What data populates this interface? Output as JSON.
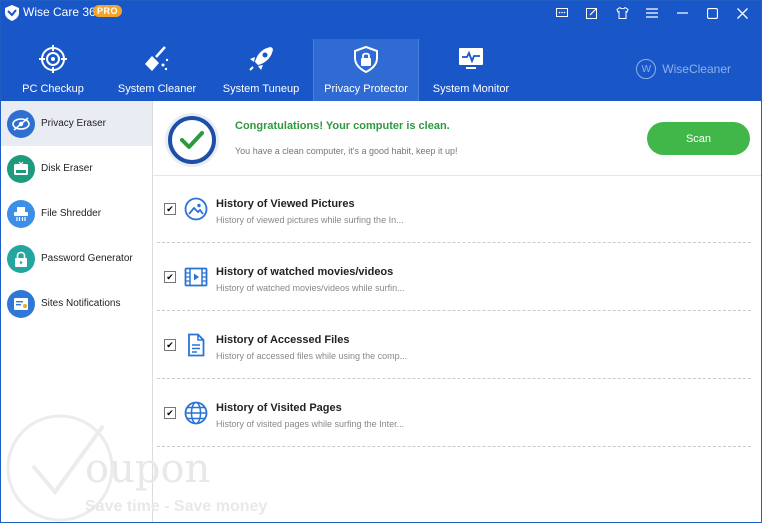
{
  "app": {
    "title": "Wise Care 365",
    "badge": "PRO",
    "brand": "WiseCleaner",
    "brand_initial": "W"
  },
  "window_controls": [
    "chat-icon",
    "edit-icon",
    "shirt-icon",
    "menu-icon",
    "minimize-icon",
    "maximize-icon",
    "close-icon"
  ],
  "nav": {
    "tabs": [
      {
        "label": "PC Checkup",
        "icon": "target-icon"
      },
      {
        "label": "System Cleaner",
        "icon": "broom-icon"
      },
      {
        "label": "System Tuneup",
        "icon": "rocket-icon"
      },
      {
        "label": "Privacy Protector",
        "icon": "lock-shield-icon",
        "active": true
      },
      {
        "label": "System Monitor",
        "icon": "monitor-icon"
      }
    ]
  },
  "sidebar": {
    "items": [
      {
        "label": "Privacy Eraser",
        "icon": "eye-slash-icon",
        "color": "#2f6fd2",
        "active": true
      },
      {
        "label": "Disk Eraser",
        "icon": "disk-icon",
        "color": "#1e9a7d"
      },
      {
        "label": "File Shredder",
        "icon": "shredder-icon",
        "color": "#3d8ee6"
      },
      {
        "label": "Password Generator",
        "icon": "padlock-icon",
        "color": "#23a6a0"
      },
      {
        "label": "Sites Notifications",
        "icon": "notification-icon",
        "color": "#2f78d6"
      }
    ]
  },
  "status": {
    "title": "Congratulations! Your computer is clean.",
    "subtitle": "You have a clean computer, it's a good habit, keep it up!",
    "scan_label": "Scan",
    "title_color": "#2e9a3f",
    "scan_color": "#42b749"
  },
  "items": [
    {
      "title": "History of Viewed Pictures",
      "desc": "History of viewed pictures while surfing the In...",
      "icon": "image-icon",
      "checked": true
    },
    {
      "title": "History of watched movies/videos",
      "desc": "History of watched movies/videos while surfin...",
      "icon": "film-icon",
      "checked": true
    },
    {
      "title": "History of Accessed Files",
      "desc": "History of accessed files while using the comp...",
      "icon": "document-icon",
      "checked": true
    },
    {
      "title": "History of Visited Pages",
      "desc": "History of visited pages while surfing the Inter...",
      "icon": "globe-icon",
      "checked": true
    }
  ],
  "watermark": {
    "text": "oupon",
    "tagline": "Save time - Save money"
  },
  "colors": {
    "header": "#1957c9",
    "accent_blue": "#2a73d6"
  }
}
